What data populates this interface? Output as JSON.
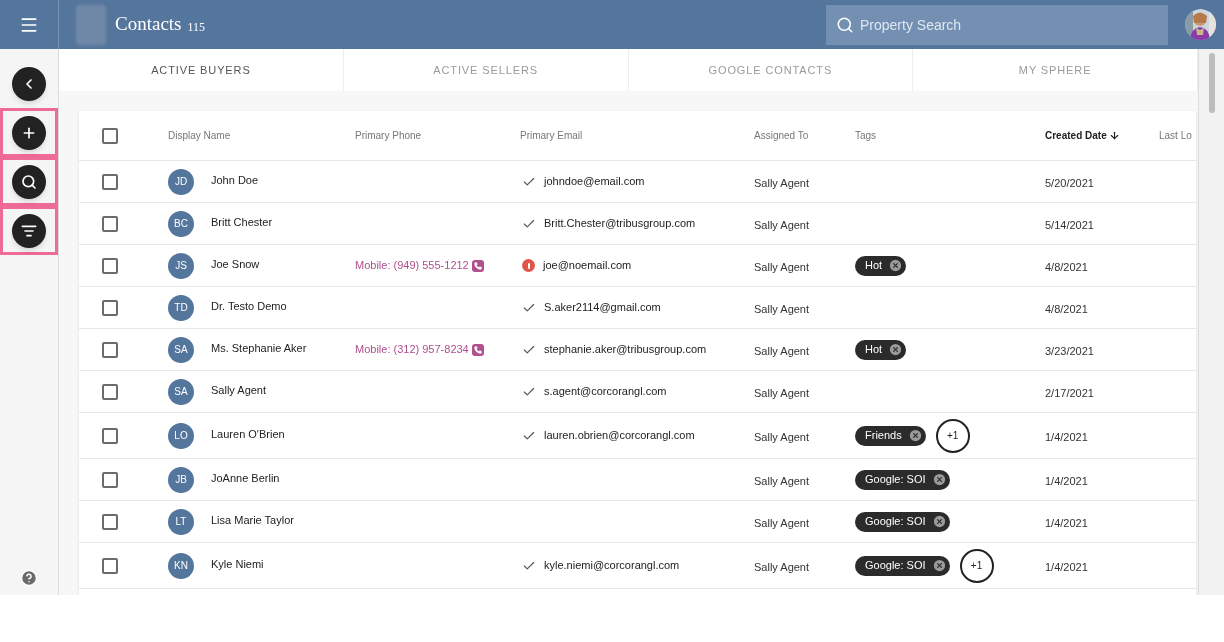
{
  "header": {
    "title": "Contacts",
    "count": "115",
    "search": {
      "placeholder": "Property Search"
    }
  },
  "sidebar": {
    "buttons": [
      {
        "kind": "back",
        "highlighted": false
      },
      {
        "kind": "add",
        "highlighted": true
      },
      {
        "kind": "search",
        "highlighted": true
      },
      {
        "kind": "sort",
        "highlighted": true
      }
    ]
  },
  "tabs": [
    {
      "label": "ACTIVE BUYERS",
      "selected": true
    },
    {
      "label": "ACTIVE SELLERS",
      "selected": false
    },
    {
      "label": "GOOGLE CONTACTS",
      "selected": false
    },
    {
      "label": "MY SPHERE",
      "selected": false
    }
  ],
  "table": {
    "select_all_checked": false,
    "columns": [
      {
        "label": "Display Name",
        "sorted": false
      },
      {
        "label": "Primary Phone",
        "sorted": false
      },
      {
        "label": "Primary Email",
        "sorted": false
      },
      {
        "label": "Assigned To",
        "sorted": false
      },
      {
        "label": "Tags",
        "sorted": false
      },
      {
        "label": "Created Date",
        "sorted": true
      },
      {
        "label": "Last Lo",
        "sorted": false
      }
    ],
    "rows": [
      {
        "checked": false,
        "initials": "JD",
        "name": "John Doe",
        "email": {
          "kind": "verified",
          "text": "johndoe@email.com"
        },
        "assigned": "Sally Agent",
        "tags": [],
        "created": "5/20/2021"
      },
      {
        "checked": false,
        "initials": "BC",
        "name": "Britt Chester",
        "email": {
          "kind": "verified",
          "text": "Britt.Chester@tribusgroup.com"
        },
        "assigned": "Sally Agent",
        "tags": [],
        "created": "5/14/2021"
      },
      {
        "checked": false,
        "initials": "JS",
        "name": "Joe Snow",
        "phone": "Mobile: (949) 555-1212",
        "email": {
          "kind": "error",
          "text": "joe@noemail.com"
        },
        "assigned": "Sally Agent",
        "tags": [
          "Hot"
        ],
        "created": "4/8/2021"
      },
      {
        "checked": false,
        "initials": "TD",
        "name": "Dr. Testo Demo",
        "email": {
          "kind": "verified",
          "text": "S.aker2114@gmail.com"
        },
        "assigned": "Sally Agent",
        "tags": [],
        "created": "4/8/2021"
      },
      {
        "checked": false,
        "initials": "SA",
        "name": "Ms. Stephanie Aker",
        "phone": "Mobile: (312) 957-8234",
        "email": {
          "kind": "verified",
          "text": "stephanie.aker@tribusgroup.com"
        },
        "assigned": "Sally Agent",
        "tags": [
          "Hot"
        ],
        "created": "3/23/2021"
      },
      {
        "checked": false,
        "initials": "SA",
        "name": "Sally Agent",
        "email": {
          "kind": "verified",
          "text": "s.agent@corcorangl.com"
        },
        "assigned": "Sally Agent",
        "tags": [],
        "created": "2/17/2021"
      },
      {
        "checked": false,
        "initials": "LO",
        "name": "Lauren O'Brien",
        "email": {
          "kind": "verified",
          "text": "lauren.obrien@corcorangl.com"
        },
        "assigned": "Sally Agent",
        "tags": [
          "Friends"
        ],
        "more": "+1",
        "created": "1/4/2021"
      },
      {
        "checked": false,
        "initials": "JB",
        "name": "JoAnne Berlin",
        "assigned": "Sally Agent",
        "tags": [
          "Google: SOI"
        ],
        "created": "1/4/2021"
      },
      {
        "checked": false,
        "initials": "LT",
        "name": "Lisa Marie Taylor",
        "assigned": "Sally Agent",
        "tags": [
          "Google: SOI"
        ],
        "created": "1/4/2021"
      },
      {
        "checked": false,
        "initials": "KN",
        "name": "Kyle Niemi",
        "email": {
          "kind": "verified",
          "text": "kyle.niemi@corcorangl.com"
        },
        "assigned": "Sally Agent",
        "tags": [
          "Google: SOI"
        ],
        "more": "+1",
        "created": "1/4/2021"
      }
    ]
  }
}
